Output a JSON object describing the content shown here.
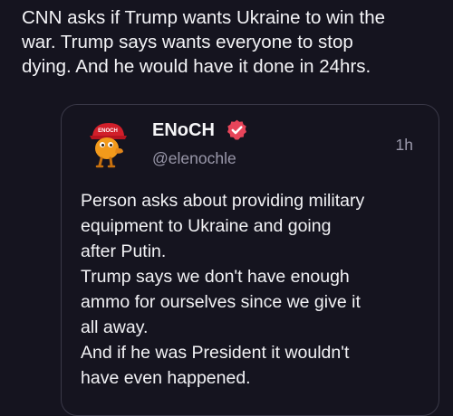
{
  "post": {
    "text": "CNN asks if Trump wants Ukraine to win the\nwar. Trump says wants everyone to stop\ndying. And he would have it done in 24hrs."
  },
  "quote": {
    "author_name": "ENoCH",
    "author_handle": "@elenochle",
    "timestamp": "1h",
    "avatar_icon": "orange-cartoon-avatar-red-cap-icon",
    "verified_icon": "verified-badge-icon",
    "verified_color": "#e8455a",
    "cap_text": "ENOCH",
    "body": "Person asks about providing military\nequipment to Ukraine and going\nafter Putin.\nTrump says we don't have enough\nammo for ourselves since we give it\nall away.\nAnd if he was President it wouldn't\nhave even happened."
  }
}
